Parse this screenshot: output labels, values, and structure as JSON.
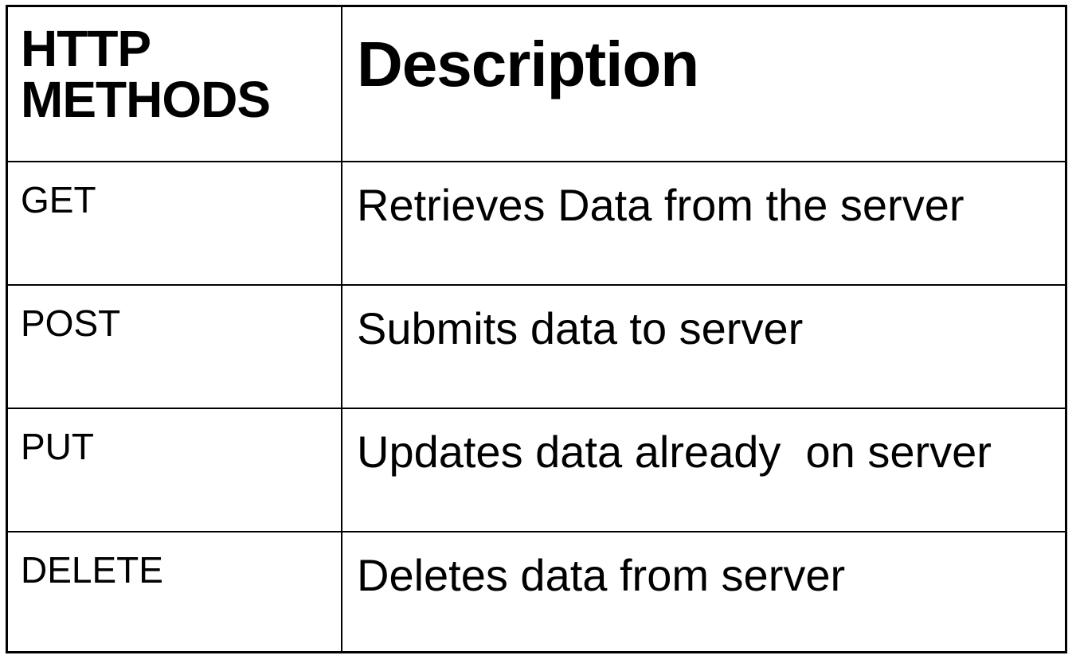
{
  "table": {
    "headers": {
      "method_line1": "HTTP",
      "method_line2": "METHODS",
      "description": "Description"
    },
    "rows": [
      {
        "method": "GET",
        "description": "Retrieves Data from the server"
      },
      {
        "method": "POST",
        "description": "Submits data to server"
      },
      {
        "method": "PUT",
        "description": "Updates data already  on server"
      },
      {
        "method": "DELETE",
        "description": "Deletes data from server"
      }
    ]
  }
}
